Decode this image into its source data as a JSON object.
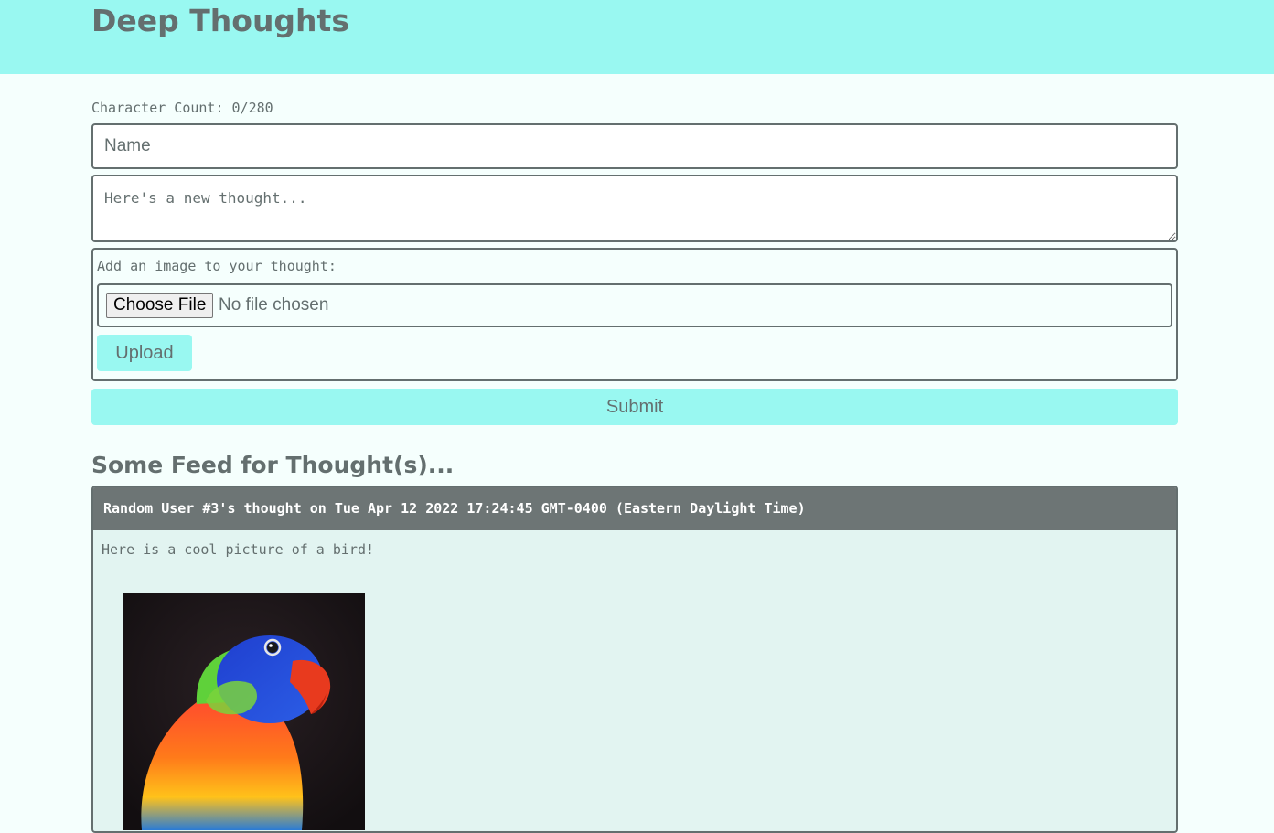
{
  "header": {
    "title": "Deep Thoughts"
  },
  "form": {
    "char_count": "Character Count: 0/280",
    "name_placeholder": "Name",
    "thought_placeholder": "Here's a new thought...",
    "image_label": "Add an image to your thought:",
    "choose_file_label": "Choose File",
    "file_status": "No file chosen",
    "upload_label": "Upload",
    "submit_label": "Submit"
  },
  "feed": {
    "title": "Some Feed for Thought(s)...",
    "thoughts": [
      {
        "header": "Random User #3's thought on Tue Apr 12 2022 17:24:45 GMT-0400 (Eastern Daylight Time)",
        "text": "Here is a cool picture of a bird!",
        "image": "rainbow-lorikeet-photo"
      }
    ]
  },
  "colors": {
    "accent": "#99f8f1",
    "text": "#646f6f",
    "card_header_bg": "#6d7575",
    "card_bg": "#e2f4f1",
    "page_bg": "#f5fffd"
  }
}
